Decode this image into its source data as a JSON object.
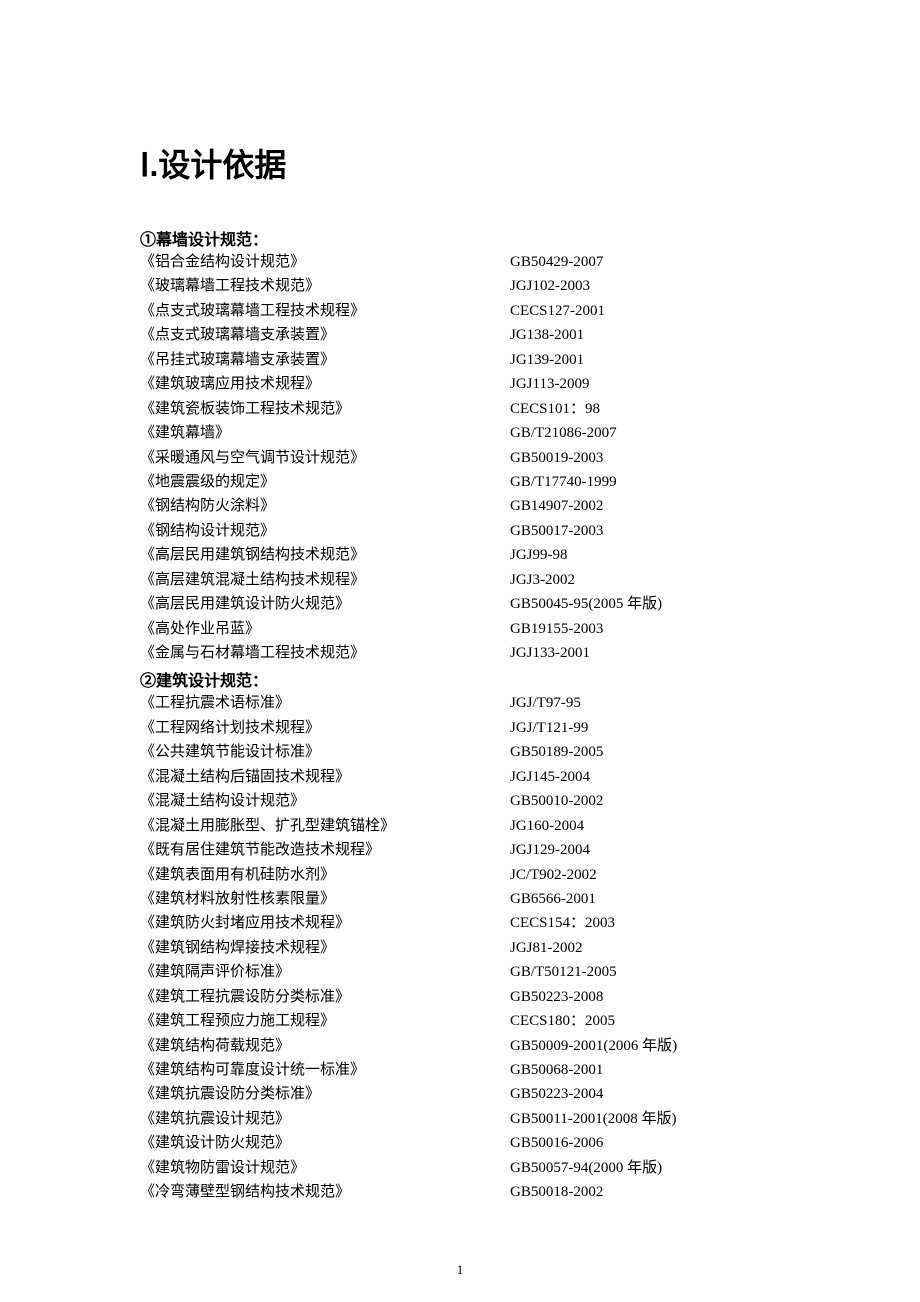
{
  "page": {
    "title": "Ⅰ.设计依据",
    "page_number": "1"
  },
  "sections": [
    {
      "header": "①幕墙设计规范：",
      "items": [
        {
          "name": "《铝合金结构设计规范》",
          "code": "GB50429-2007"
        },
        {
          "name": "《玻璃幕墙工程技术规范》",
          "code": "JGJ102-2003"
        },
        {
          "name": "《点支式玻璃幕墙工程技术规程》",
          "code": "CECS127-2001"
        },
        {
          "name": "《点支式玻璃幕墙支承装置》",
          "code": "JG138-2001"
        },
        {
          "name": "《吊挂式玻璃幕墙支承装置》",
          "code": "JG139-2001"
        },
        {
          "name": "《建筑玻璃应用技术规程》",
          "code": "JGJ113-2009"
        },
        {
          "name": "《建筑瓷板装饰工程技术规范》",
          "code": "CECS101：98"
        },
        {
          "name": "《建筑幕墙》",
          "code": "GB/T21086-2007"
        },
        {
          "name": "《采暖通风与空气调节设计规范》",
          "code": "GB50019-2003"
        },
        {
          "name": "《地震震级的规定》",
          "code": "GB/T17740-1999"
        },
        {
          "name": "《钢结构防火涂料》",
          "code": "GB14907-2002"
        },
        {
          "name": "《钢结构设计规范》",
          "code": "GB50017-2003"
        },
        {
          "name": "《高层民用建筑钢结构技术规范》",
          "code": "JGJ99-98"
        },
        {
          "name": "《高层建筑混凝土结构技术规程》",
          "code": "JGJ3-2002"
        },
        {
          "name": "《高层民用建筑设计防火规范》",
          "code": "GB50045-95(2005 年版)"
        },
        {
          "name": "《高处作业吊蓝》",
          "code": "GB19155-2003"
        },
        {
          "name": "《金属与石材幕墙工程技术规范》",
          "code": "JGJ133-2001"
        }
      ]
    },
    {
      "header": "②建筑设计规范：",
      "items": [
        {
          "name": "《工程抗震术语标准》",
          "code": "JGJ/T97-95"
        },
        {
          "name": "《工程网络计划技术规程》",
          "code": "JGJ/T121-99"
        },
        {
          "name": "《公共建筑节能设计标准》",
          "code": "GB50189-2005"
        },
        {
          "name": "《混凝土结构后锚固技术规程》",
          "code": "JGJ145-2004"
        },
        {
          "name": "《混凝土结构设计规范》",
          "code": "GB50010-2002"
        },
        {
          "name": "《混凝土用膨胀型、扩孔型建筑锚栓》",
          "code": "JG160-2004"
        },
        {
          "name": "《既有居住建筑节能改造技术规程》",
          "code": "JGJ129-2004"
        },
        {
          "name": "《建筑表面用有机硅防水剂》",
          "code": "JC/T902-2002"
        },
        {
          "name": "《建筑材料放射性核素限量》",
          "code": "GB6566-2001"
        },
        {
          "name": "《建筑防火封堵应用技术规程》",
          "code": "CECS154：2003"
        },
        {
          "name": "《建筑钢结构焊接技术规程》",
          "code": "JGJ81-2002"
        },
        {
          "name": "《建筑隔声评价标准》",
          "code": "GB/T50121-2005"
        },
        {
          "name": "《建筑工程抗震设防分类标准》",
          "code": "GB50223-2008"
        },
        {
          "name": "《建筑工程预应力施工规程》",
          "code": "CECS180：2005"
        },
        {
          "name": "《建筑结构荷载规范》",
          "code": "GB50009-2001(2006 年版)"
        },
        {
          "name": "《建筑结构可靠度设计统一标准》",
          "code": "GB50068-2001"
        },
        {
          "name": "《建筑抗震设防分类标准》",
          "code": "GB50223-2004"
        },
        {
          "name": "《建筑抗震设计规范》",
          "code": "GB50011-2001(2008 年版)"
        },
        {
          "name": "《建筑设计防火规范》",
          "code": "GB50016-2006"
        },
        {
          "name": "《建筑物防雷设计规范》",
          "code": "GB50057-94(2000 年版)"
        },
        {
          "name": "《冷弯薄壁型钢结构技术规范》",
          "code": "GB50018-2002"
        }
      ]
    }
  ]
}
